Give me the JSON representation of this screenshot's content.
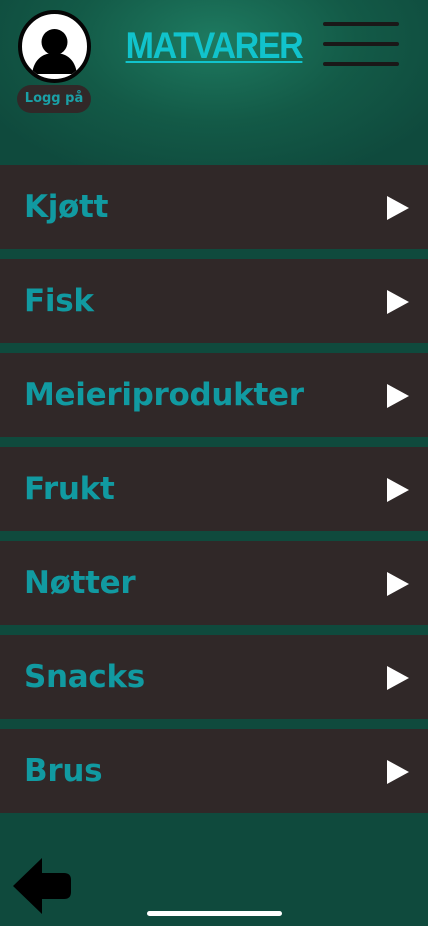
{
  "header": {
    "title": "MATVARER",
    "login_label": "Logg på",
    "avatar_icon": "user-avatar-icon",
    "menu_icon": "hamburger-menu-icon"
  },
  "categories": [
    {
      "label": "Kjøtt",
      "icon": "play-arrow-icon"
    },
    {
      "label": "Fisk",
      "icon": "play-arrow-icon"
    },
    {
      "label": "Meieriprodukter",
      "icon": "play-arrow-icon"
    },
    {
      "label": "Frukt",
      "icon": "play-arrow-icon"
    },
    {
      "label": "Nøtter",
      "icon": "play-arrow-icon"
    },
    {
      "label": "Snacks",
      "icon": "play-arrow-icon"
    },
    {
      "label": "Brus",
      "icon": "play-arrow-icon"
    }
  ],
  "footer": {
    "back_icon": "back-arrow-icon"
  },
  "colors": {
    "background": "#0f4a3d",
    "header_glow": "#1e7a60",
    "item_background": "#302828",
    "accent_text": "#119aa1",
    "title_text": "#11c3cc",
    "arrow": "#ffffff"
  }
}
